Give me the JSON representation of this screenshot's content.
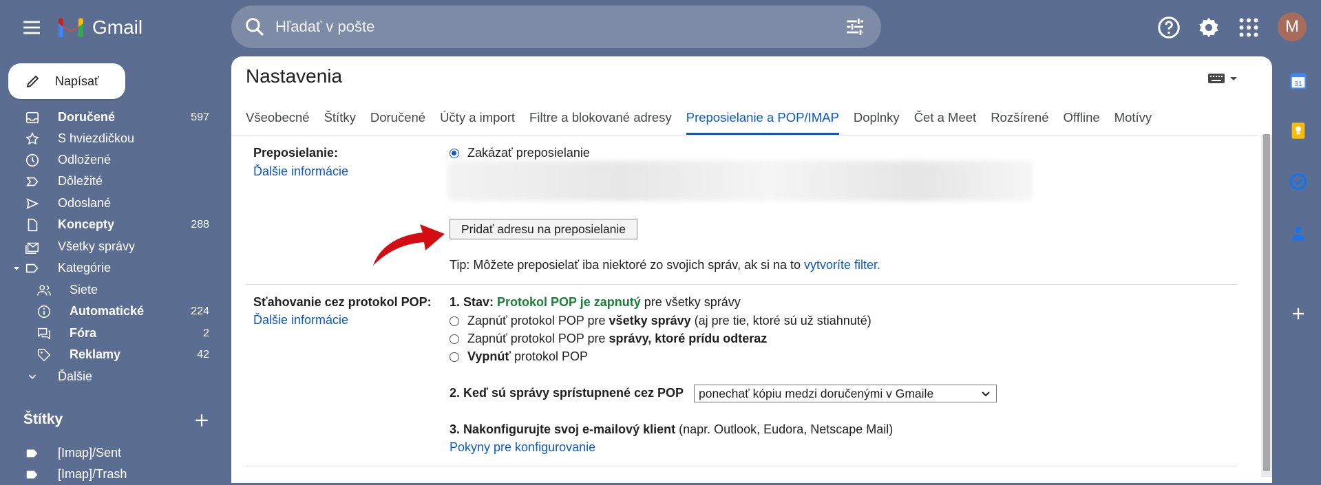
{
  "app": {
    "name": "Gmail",
    "avatar_letter": "M"
  },
  "search": {
    "placeholder": "Hľadať v pošte"
  },
  "compose": {
    "label": "Napísať"
  },
  "sidebar": {
    "items": [
      {
        "label": "Doručené",
        "count": "597",
        "bold": true
      },
      {
        "label": "S hviezdičkou",
        "count": ""
      },
      {
        "label": "Odložené",
        "count": ""
      },
      {
        "label": "Dôležité",
        "count": ""
      },
      {
        "label": "Odoslané",
        "count": ""
      },
      {
        "label": "Koncepty",
        "count": "288",
        "bold": true
      },
      {
        "label": "Všetky správy",
        "count": ""
      },
      {
        "label": "Kategórie",
        "count": ""
      },
      {
        "label": "Siete",
        "count": ""
      },
      {
        "label": "Automatické",
        "count": "224",
        "bold": true
      },
      {
        "label": "Fóra",
        "count": "2",
        "bold": true
      },
      {
        "label": "Reklamy",
        "count": "42",
        "bold": true
      },
      {
        "label": "Ďalšie",
        "count": ""
      }
    ],
    "labels_title": "Štítky",
    "labels": [
      "[Imap]/Sent",
      "[Imap]/Trash"
    ]
  },
  "settings": {
    "title": "Nastavenia",
    "tabs": [
      "Všeobecné",
      "Štítky",
      "Doručené",
      "Účty a import",
      "Filtre a blokované adresy",
      "Preposielanie a POP/IMAP",
      "Doplnky",
      "Čet a Meet",
      "Rozšírené",
      "Offline",
      "Motívy"
    ],
    "forwarding": {
      "title": "Preposielanie:",
      "more": "Ďalšie informácie",
      "disable": "Zakázať preposielanie",
      "add_button": "Pridať adresu na preposielanie",
      "tip_prefix": "Tip: Môžete preposielať iba niektoré zo svojich správ, ak si na to ",
      "tip_link": "vytvoríte filter."
    },
    "pop": {
      "title": "Sťahovanie cez protokol POP:",
      "more": "Ďalšie informácie",
      "status_label": "1. Stav: ",
      "status_value": "Protokol POP je zapnutý",
      "status_suffix": " pre všetky správy",
      "opt1_prefix": "Zapnúť protokol POP pre ",
      "opt1_bold": "všetky správy",
      "opt1_suffix": " (aj pre tie, ktoré sú už stiahnuté)",
      "opt2_prefix": "Zapnúť protokol POP pre ",
      "opt2_bold": "správy, ktoré prídu odteraz",
      "opt3_bold": "Vypnúť",
      "opt3_suffix": " protokol POP",
      "step2_label": "2. Keď sú správy sprístupnené cez POP",
      "step2_select": "ponechať kópiu medzi doručenými v Gmaile",
      "step3_bold": "3. Nakonfigurujte svoj e-mailový klient",
      "step3_suffix": " (napr. Outlook, Eudora, Netscape Mail)",
      "step3_link": "Pokyny pre konfigurovanie"
    }
  },
  "colors": {
    "accent": "#0b57d0",
    "background": "#5b6e91",
    "status_green": "#188038",
    "arrow": "#d40d12"
  }
}
